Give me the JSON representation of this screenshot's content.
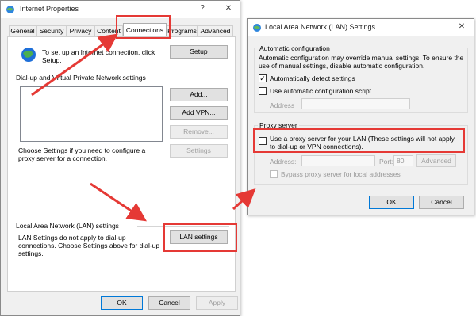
{
  "internet_properties": {
    "title": "Internet Properties",
    "tabs": [
      "General",
      "Security",
      "Privacy",
      "Content",
      "Connections",
      "Programs",
      "Advanced"
    ],
    "setup_text": "To set up an Internet connection, click Setup.",
    "setup_button": "Setup",
    "dialup_header": "Dial-up and Virtual Private Network settings",
    "add_button": "Add...",
    "add_vpn_button": "Add VPN...",
    "remove_button": "Remove...",
    "settings_button": "Settings",
    "settings_text": "Choose Settings if you need to configure a proxy server for a connection.",
    "lan_header": "Local Area Network (LAN) settings",
    "lan_text": "LAN Settings do not apply to dial-up connections. Choose Settings above for dial-up settings.",
    "lan_settings_button": "LAN settings",
    "ok_button": "OK",
    "cancel_button": "Cancel",
    "apply_button": "Apply"
  },
  "lan_dialog": {
    "title": "Local Area Network (LAN) Settings",
    "auto_config_header": "Automatic configuration",
    "auto_config_text": "Automatic configuration may override manual settings. To ensure the use of manual settings, disable automatic configuration.",
    "auto_detect_label": "Automatically detect settings",
    "auto_detect_checked": true,
    "auto_script_label": "Use automatic configuration script",
    "auto_script_checked": false,
    "address_label": "Address",
    "proxy_header": "Proxy server",
    "proxy_label": "Use a proxy server for your LAN (These settings will not apply to dial-up or VPN connections).",
    "proxy_checked": false,
    "proxy_address_label": "Address:",
    "port_label": "Port:",
    "port_value": "80",
    "advanced_button": "Advanced",
    "bypass_label": "Bypass proxy server for local addresses",
    "ok_button": "OK",
    "cancel_button": "Cancel"
  },
  "colors": {
    "highlight": "#e53935",
    "accent": "#0078d7"
  }
}
